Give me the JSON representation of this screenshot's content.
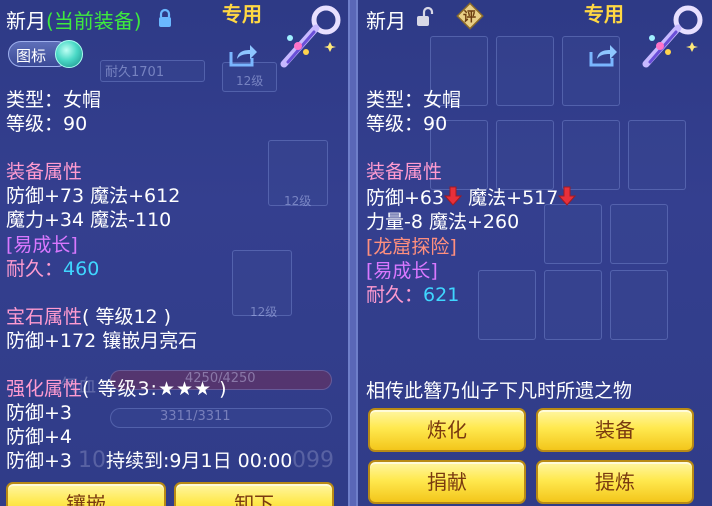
{
  "left": {
    "name": "新月",
    "equip_status": "(当前装备)",
    "tag_label": "图标",
    "exclusive": "专用",
    "type_line": "类型：女帽",
    "level_line": "等级：90",
    "attr_heading": "装备属性",
    "attr_line1": "防御+73 魔法+612",
    "attr_line2": "魔力+34 魔法-110",
    "growth": "[易成长]",
    "durability_label": "耐久：",
    "durability_value": "460",
    "gem_heading": "宝石属性",
    "gem_level": "( 等级12 )",
    "gem_line": "防御+172 镶嵌月亮石",
    "enhance_heading": "强化属性",
    "enhance_level": "( 等级3:★★★ )",
    "enhance_line1": "防御+3",
    "enhance_line2": "防御+4",
    "enhance_line3": "防御+3",
    "enhance_duration": "持续到:9月1日 00:00",
    "bg_texts": [
      "耐久1701",
      "12级",
      "12级",
      "12级",
      "4250/4250",
      "3311/3311",
      "10",
      "099",
      "气血"
    ],
    "buttons": [
      "镶嵌",
      "卸下"
    ]
  },
  "right": {
    "name": "新月",
    "review_badge": "评",
    "exclusive": "专用",
    "type_line": "类型：女帽",
    "level_line": "等级：90",
    "attr_heading": "装备属性",
    "attr_line1_a": "防御+63",
    "attr_line1_b": "魔法+517",
    "attr_line2": "力量-8 魔法+260",
    "dragon": "[龙窟探险]",
    "growth": "[易成长]",
    "durability_label": "耐久：",
    "durability_value": "621",
    "description": "相传此簪乃仙子下凡时所遗之物",
    "buttons": {
      "refine": "炼化",
      "equip": "装备",
      "donate": "捐献",
      "extract": "提炼"
    }
  },
  "colors": {
    "panel": "#343f8f",
    "gold_text": "#ffd843",
    "pink": "#ff9bd0",
    "cyan": "#3fd6ff",
    "purple": "#d978ff",
    "button": "#ffe94f",
    "decrease_arrow": "#e8303a"
  },
  "icons": [
    "lock-icon",
    "unlock-icon",
    "share-icon",
    "hairpin-item-icon",
    "review-badge-icon",
    "down-arrow-icon"
  ]
}
